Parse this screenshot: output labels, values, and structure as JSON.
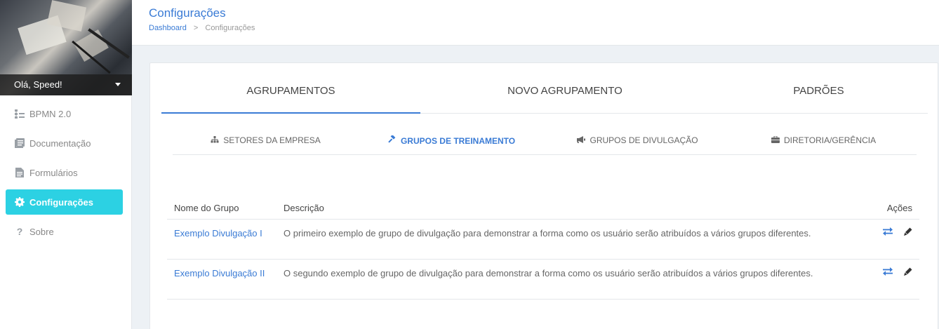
{
  "sidebar": {
    "greeting": "Olá, Speed!",
    "items": [
      {
        "label": "BPMN 2.0",
        "icon": "sitemap-icon"
      },
      {
        "label": "Documentação",
        "icon": "book-icon"
      },
      {
        "label": "Formulários",
        "icon": "file-icon"
      },
      {
        "label": "Configurações",
        "icon": "gear-icon",
        "active": true
      },
      {
        "label": "Sobre",
        "icon": "question-icon"
      }
    ]
  },
  "header": {
    "title": "Configurações",
    "breadcrumb": {
      "link": "Dashboard",
      "separator": ">",
      "current": "Configurações"
    }
  },
  "main_tabs": [
    {
      "label": "AGRUPAMENTOS",
      "active": true
    },
    {
      "label": "NOVO AGRUPAMENTO"
    },
    {
      "label": "PADRÕES"
    }
  ],
  "sub_tabs": [
    {
      "label": "SETORES DA EMPRESA",
      "icon": "sitemap-icon"
    },
    {
      "label": "GRUPOS DE TREINAMENTO",
      "icon": "gavel-icon",
      "active": true
    },
    {
      "label": "GRUPOS DE DIVULGAÇÃO",
      "icon": "bullhorn-icon"
    },
    {
      "label": "DIRETORIA/GERÊNCIA",
      "icon": "briefcase-icon"
    }
  ],
  "table": {
    "headers": {
      "name": "Nome do Grupo",
      "description": "Descrição",
      "actions": "Ações"
    },
    "rows": [
      {
        "name": "Exemplo Divulgação I",
        "description": "O primeiro exemplo de grupo de divulgação para demonstrar a forma como os usuário serão atribuídos a vários grupos diferentes."
      },
      {
        "name": "Exemplo Divulgação II",
        "description": "O segundo exemplo de grupo de divulgação para demonstrar a forma como os usuário serão atribuídos a vários grupos diferentes."
      }
    ]
  },
  "colors": {
    "accent": "#3a7bd5",
    "active_nav": "#2cd1e3"
  }
}
